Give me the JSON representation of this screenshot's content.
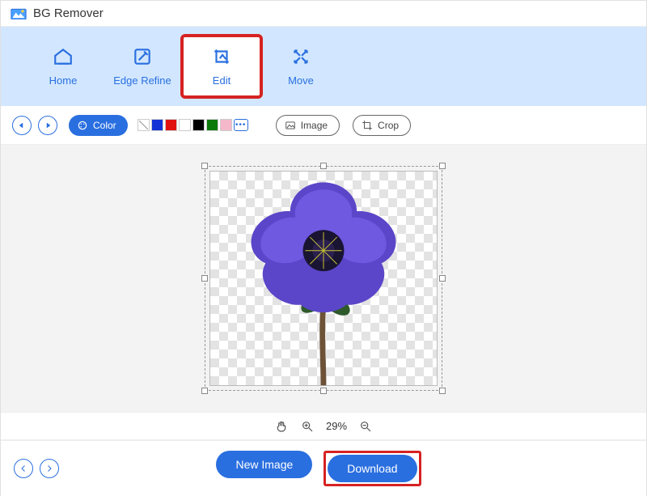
{
  "app": {
    "title": "BG Remover"
  },
  "tabs": {
    "home": "Home",
    "edge": "Edge Refine",
    "edit": "Edit",
    "move": "Move"
  },
  "subbar": {
    "color_label": "Color",
    "image_label": "Image",
    "crop_label": "Crop",
    "swatches": [
      "none",
      "#1432d6",
      "#e11111",
      "#ffffff",
      "#000000",
      "#0a7a0a",
      "#f5b8ca"
    ]
  },
  "zoom": {
    "percent": "29%"
  },
  "bottom": {
    "new_image": "New Image",
    "download": "Download"
  }
}
